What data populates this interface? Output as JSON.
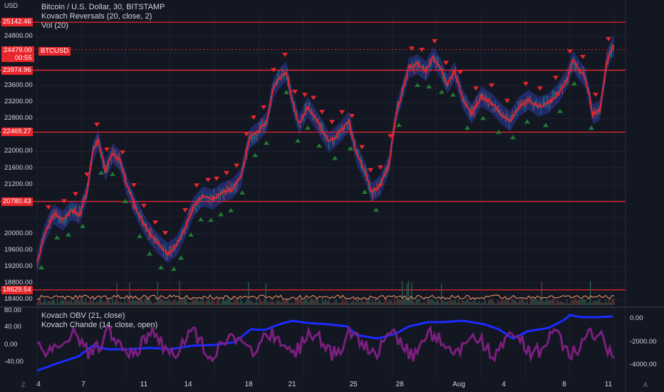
{
  "header": {
    "currency": "USD",
    "title": "Bitcoin / U.S. Dollar, 30, BITSTAMP",
    "indicator1": "Kovach Reversals (20, close, 2)",
    "indicator2": "Vol (20)"
  },
  "price_axis": [
    "24800.00",
    "23600.00",
    "23200.00",
    "22800.00",
    "22000.00",
    "21600.00",
    "21200.00",
    "20000.00",
    "19600.00",
    "19200.00",
    "18800.00",
    "18400.00"
  ],
  "price_axis_values": [
    24800,
    23600,
    23200,
    22800,
    22000,
    21600,
    21200,
    20000,
    19600,
    19200,
    18800,
    18400
  ],
  "levels": [
    "25142.46",
    "23974.96",
    "22469.27",
    "20780.43",
    "18629.54"
  ],
  "level_values": [
    25142.46,
    23974.96,
    22469.27,
    20780.43,
    18629.54
  ],
  "current_price": {
    "value": "24479.00",
    "countdown": "00:55",
    "symbol": "BTCUSD"
  },
  "lower_pane": {
    "indicator1": "Kovach OBV (21, close)",
    "indicator2": "Kovach Chande (14, close, open)",
    "left_axis": [
      "80.00",
      "40.00",
      "0.00",
      "-40.00"
    ],
    "right_axis": [
      "0.00",
      "-2000.00",
      "-4000.00"
    ]
  },
  "time_axis": [
    "4",
    "7",
    "11",
    "14",
    "18",
    "21",
    "25",
    "28",
    "Aug",
    "4",
    "8",
    "11"
  ],
  "corner_left": "Z",
  "corner_right": "A",
  "colors": {
    "background": "#131722",
    "level_line": "#e8262b",
    "price_line": "#e8262b",
    "band": "#2a3a9e",
    "obv": "#1c2bff",
    "chande": "#7b1f7e",
    "volume": "#4a6b5a"
  }
}
